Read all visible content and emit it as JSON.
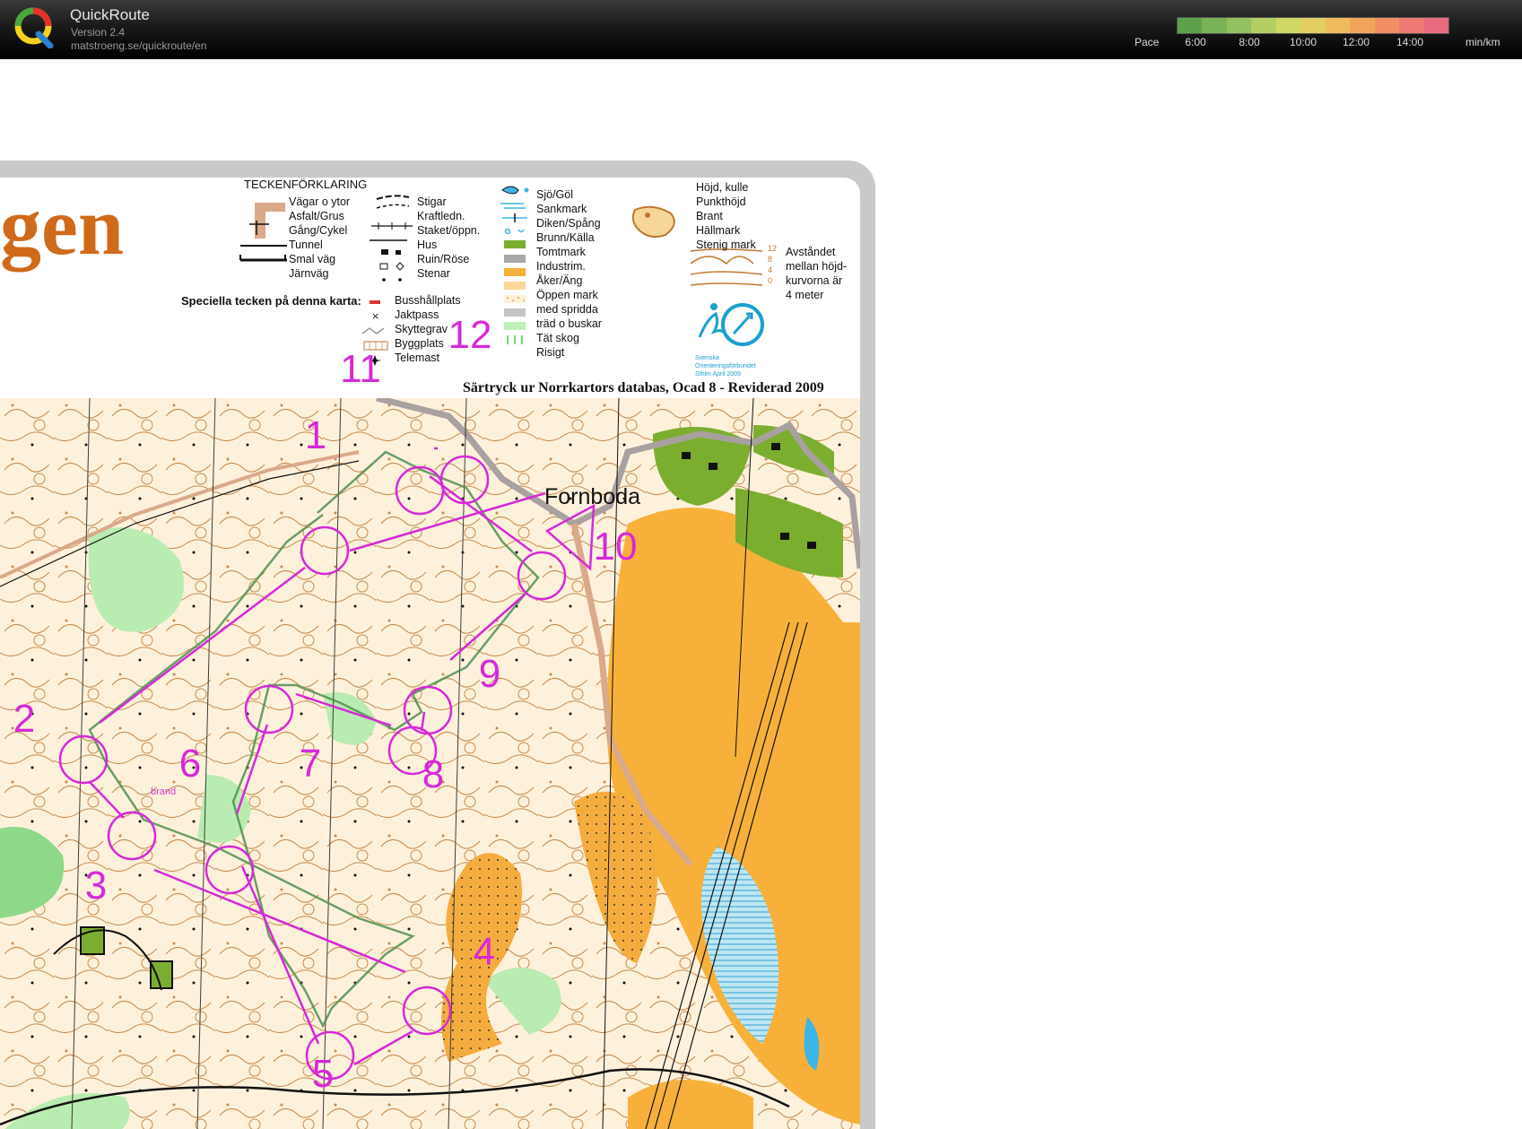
{
  "header": {
    "app_title": "QuickRoute",
    "version": "Version 2.4",
    "url": "matstroeng.se/quickroute/en",
    "pace_label": "Pace",
    "pace_ticks": [
      "6:00",
      "8:00",
      "10:00",
      "12:00",
      "14:00"
    ],
    "pace_unit": "min/km",
    "pace_colors": [
      "#5da24b",
      "#79b257",
      "#94c160",
      "#b3cf63",
      "#d0d866",
      "#e4cf63",
      "#efbb5d",
      "#f2a45a",
      "#f18e62",
      "#ee7b73",
      "#e96b80"
    ]
  },
  "map": {
    "title_fragment": "gen",
    "legend_heading": "TECKENFÖRKLARING",
    "special_heading": "Speciella tecken på denna karta:",
    "source_text": "Särtryck ur Norrkartors databas, Ocad 8 - Reviderad 2009",
    "place_name": "Fornboda",
    "brand_note": "brand",
    "legend_col1": [
      "Vägar o ytor",
      "Asfalt/Grus",
      "Gång/Cykel",
      "Tunnel",
      "Smal väg",
      "Järnväg"
    ],
    "legend_col2": [
      "Stigar",
      "Kraftledn.",
      "Staket/öppn.",
      "Hus",
      "Ruin/Röse",
      "Stenar"
    ],
    "legend_special": [
      "Busshållplats",
      "Jaktpass",
      "Skyttegrav",
      "Byggplats",
      "Telemast"
    ],
    "legend_col3": [
      "Sjö/Göl",
      "Sankmark",
      "Diken/Spång",
      "Brunn/Källa",
      "Tomtmark",
      "Industrim.",
      "Åker/Äng",
      "Öppen mark",
      "med spridda",
      "träd o buskar",
      "Tät skog",
      "Risigt"
    ],
    "legend_col4": [
      "Höjd, kulle",
      "Punkthöjd",
      "Brant",
      "Hällmark",
      "Stenig mark"
    ],
    "contour_note": [
      "Avståndet",
      "mellan höjd-",
      "kurvorna är",
      "4 meter"
    ],
    "contour_scale": [
      "12",
      "8",
      "4",
      "0"
    ],
    "sof_text": [
      "Svenska",
      "Orienteringsförbundet",
      "Sthlm April 2009"
    ],
    "controls": [
      "1",
      "2",
      "3",
      "4",
      "5",
      "6",
      "7",
      "8",
      "9",
      "10",
      "11",
      "12"
    ]
  }
}
